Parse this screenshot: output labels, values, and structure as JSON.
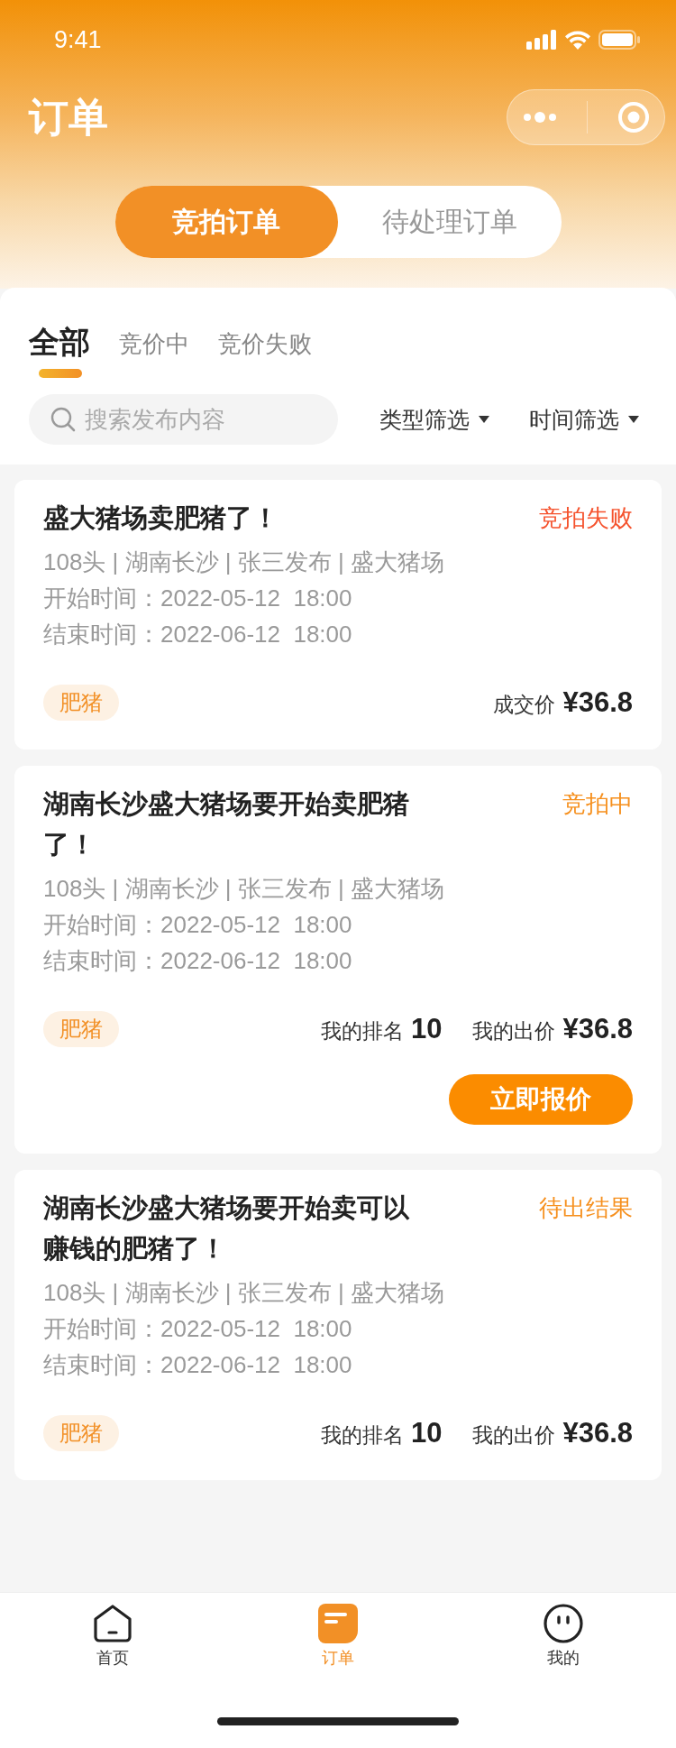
{
  "status_bar": {
    "time": "9:41"
  },
  "header": {
    "title": "订单"
  },
  "segments": [
    {
      "label": "竞拍订单",
      "selected": true
    },
    {
      "label": "待处理订单",
      "selected": false
    }
  ],
  "tabs": [
    {
      "label": "全部",
      "selected": true
    },
    {
      "label": "竞价中",
      "selected": false
    },
    {
      "label": "竞价失败",
      "selected": false
    }
  ],
  "search": {
    "placeholder": "搜索发布内容"
  },
  "filters": [
    "类型筛选",
    "时间筛选"
  ],
  "orders": [
    {
      "kind": "deal",
      "title": "盛大猪场卖肥猪了！",
      "status": "竞拍失败",
      "color": "#f5522d",
      "meta": "108头 | 湖南长沙 | 张三发布 | 盛大猪场",
      "start": "开始时间：2022-05-12  18:00",
      "end": "结束时间：2022-06-12  18:00",
      "tag": "肥猪",
      "price_label": "成交价",
      "price": "¥36.8"
    },
    {
      "kind": "bid",
      "title": "湖南长沙盛大猪场要开始卖肥猪了！",
      "status": "竞拍中",
      "color": "#f6901e",
      "meta": "108头 | 湖南长沙 | 张三发布 | 盛大猪场",
      "start": "开始时间：2022-05-12  18:00",
      "end": "结束时间：2022-06-12  18:00",
      "tag": "肥猪",
      "rank_label": "我的排名",
      "rank": "10",
      "price_label": "我的出价",
      "price": "¥36.8",
      "action": "立即报价"
    },
    {
      "kind": "bid",
      "title": "湖南长沙盛大猪场要开始卖可以赚钱的肥猪了！",
      "status": "待出结果",
      "color": "#f6901e",
      "meta": "108头 | 湖南长沙 | 张三发布 | 盛大猪场",
      "start": "开始时间：2022-05-12  18:00",
      "end": "结束时间：2022-06-12  18:00",
      "tag": "肥猪",
      "rank_label": "我的排名",
      "rank": "10",
      "price_label": "我的出价",
      "price": "¥36.8"
    }
  ],
  "nav": [
    {
      "kind": "home",
      "label": "首页",
      "selected": false
    },
    {
      "kind": "order",
      "label": "订单",
      "selected": true
    },
    {
      "kind": "me",
      "label": "我的",
      "selected": false
    }
  ]
}
